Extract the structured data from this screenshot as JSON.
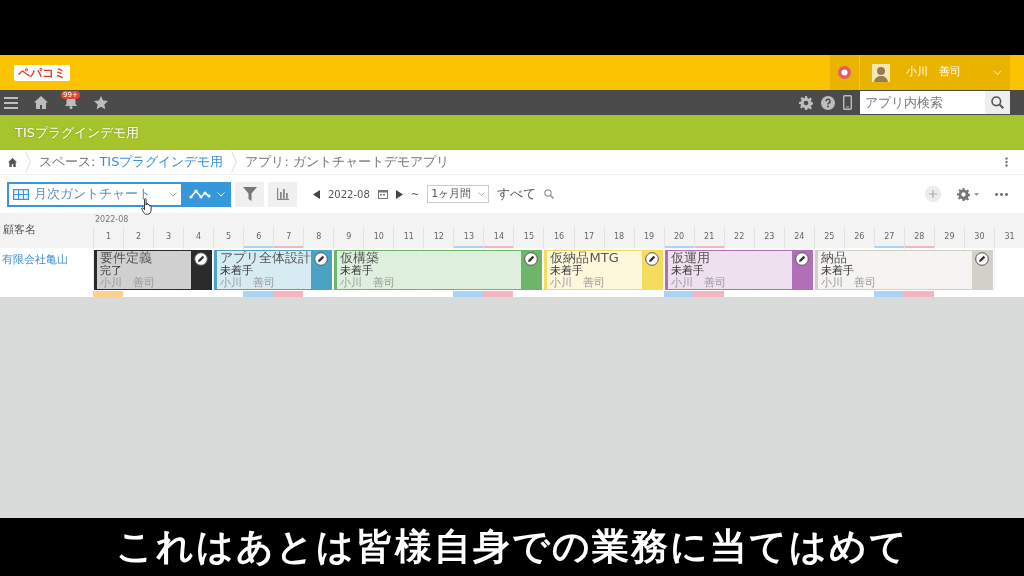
{
  "header": {
    "logo": "ペパコミ",
    "user_name": "小川　善司"
  },
  "navbar": {
    "notification_badge": "99+",
    "search": {
      "placeholder": "アプリ内検索"
    }
  },
  "space_banner": {
    "title": "TISプラグインデモ用"
  },
  "breadcrumb": [
    {
      "kind": "space",
      "label": "スペース:",
      "link": "TISプラグインデモ用"
    },
    {
      "kind": "app",
      "label": "アプリ: ガントチャートデモアプリ"
    }
  ],
  "toolbar": {
    "view": "月次ガントチャート",
    "month": "2022-08",
    "range_separator": "~",
    "period": "1ヶ月間",
    "all_link": "すべて"
  },
  "gantt": {
    "column_header": "顧客名",
    "month": "2022-08",
    "days": [
      {
        "label": "1",
        "kind": "today"
      },
      {
        "label": "2",
        "kind": "weekday"
      },
      {
        "label": "3",
        "kind": "weekday"
      },
      {
        "label": "4",
        "kind": "weekday"
      },
      {
        "label": "5",
        "kind": "weekday"
      },
      {
        "label": "6",
        "kind": "saturday"
      },
      {
        "label": "7",
        "kind": "sunday"
      },
      {
        "label": "8",
        "kind": "weekday"
      },
      {
        "label": "9",
        "kind": "weekday"
      },
      {
        "label": "10",
        "kind": "weekday"
      },
      {
        "label": "11",
        "kind": "weekday"
      },
      {
        "label": "12",
        "kind": "weekday"
      },
      {
        "label": "13",
        "kind": "saturday"
      },
      {
        "label": "14",
        "kind": "sunday"
      },
      {
        "label": "15",
        "kind": "weekday"
      },
      {
        "label": "16",
        "kind": "weekday"
      },
      {
        "label": "17",
        "kind": "weekday"
      },
      {
        "label": "18",
        "kind": "weekday"
      },
      {
        "label": "19",
        "kind": "weekday"
      },
      {
        "label": "20",
        "kind": "saturday"
      },
      {
        "label": "21",
        "kind": "sunday"
      },
      {
        "label": "22",
        "kind": "weekday"
      },
      {
        "label": "23",
        "kind": "weekday"
      },
      {
        "label": "24",
        "kind": "weekday"
      },
      {
        "label": "25",
        "kind": "weekday"
      },
      {
        "label": "26",
        "kind": "weekday"
      },
      {
        "label": "27",
        "kind": "saturday"
      },
      {
        "label": "28",
        "kind": "sunday"
      },
      {
        "label": "29",
        "kind": "weekday"
      },
      {
        "label": "30",
        "kind": "weekday"
      },
      {
        "label": "31",
        "kind": "weekday"
      }
    ],
    "rows": [
      {
        "name": "有限会社亀山",
        "bars": [
          {
            "title": "要件定義",
            "status": "完了",
            "assignee": "小川　善司",
            "color": "#2b2b2b"
          },
          {
            "title": "アプリ全体設計",
            "status": "未着手",
            "assignee": "小川　善司",
            "color": "#4ba3c3"
          },
          {
            "title": "仮構築",
            "status": "未着手",
            "assignee": "小川　善司",
            "color": "#6cb56a"
          },
          {
            "title": "仮納品MTG",
            "status": "未着手",
            "assignee": "小川　善司",
            "color": "#f5dc5e"
          },
          {
            "title": "仮運用",
            "status": "未着手",
            "assignee": "小川　善司",
            "color": "#b070b5"
          },
          {
            "title": "納品",
            "status": "未着手",
            "assignee": "小川　善司",
            "color": "#d3cfc9"
          }
        ]
      }
    ]
  },
  "subtitle": "これはあとは皆様自身での業務に当てはめて"
}
